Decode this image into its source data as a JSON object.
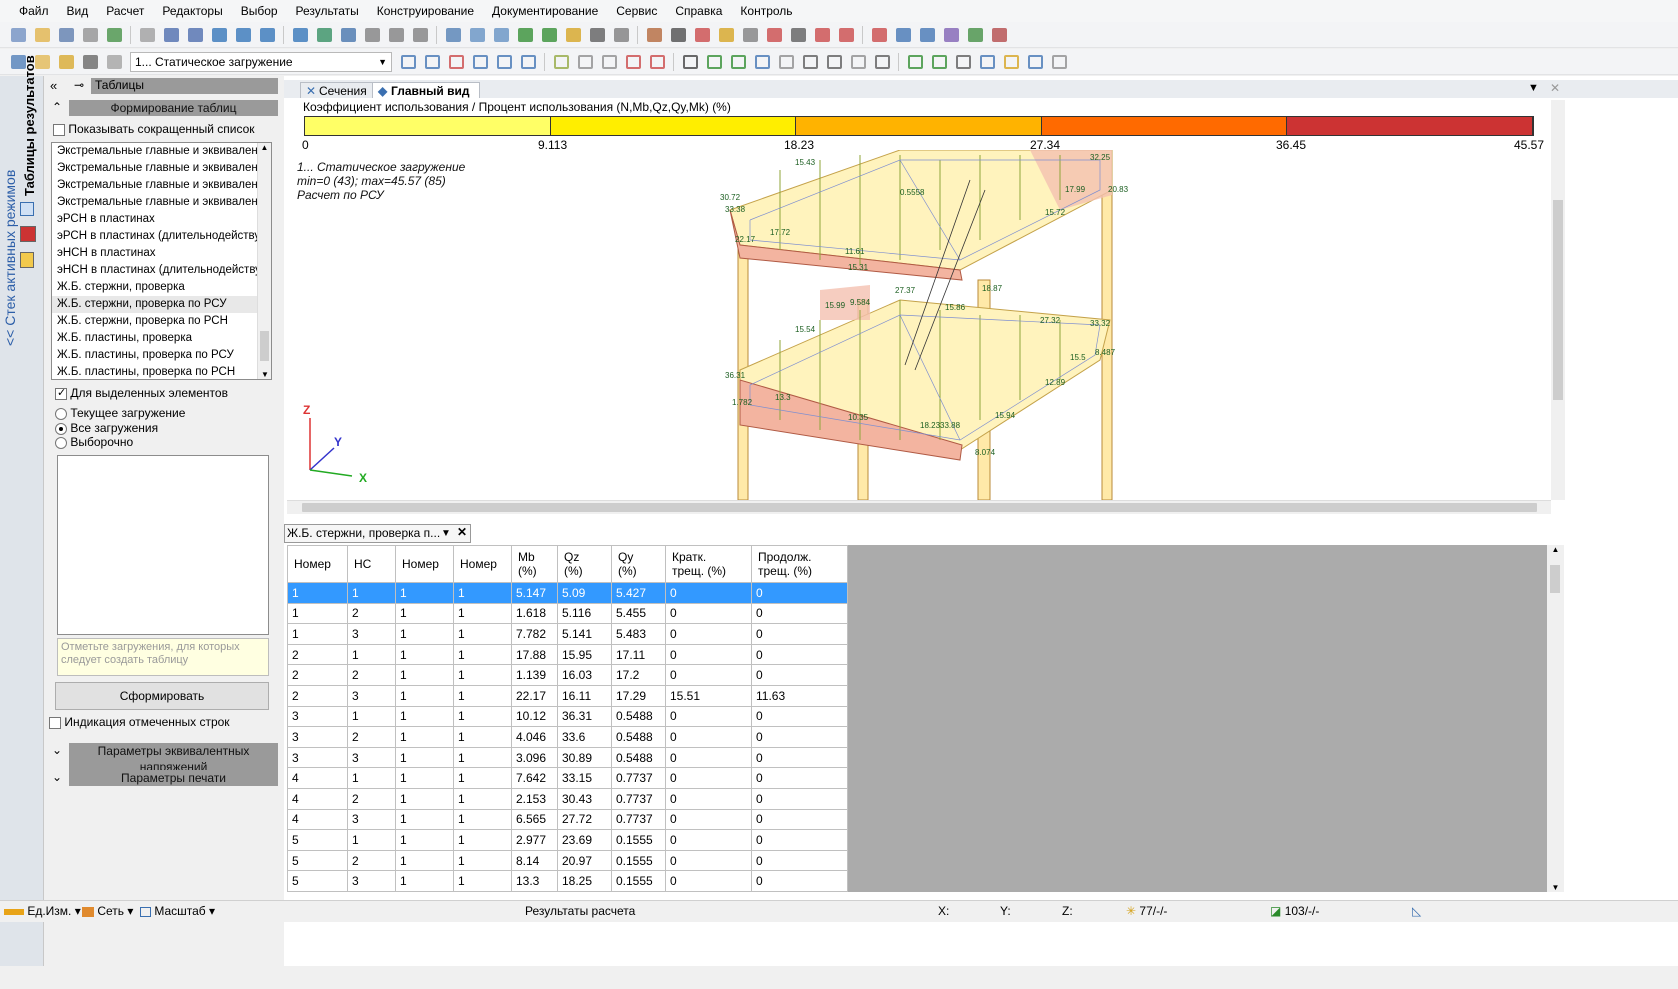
{
  "menu": [
    "Файл",
    "Вид",
    "Расчет",
    "Редакторы",
    "Выбор",
    "Результаты",
    "Конструирование",
    "Документирование",
    "Сервис",
    "Справка",
    "Контроль"
  ],
  "toolbar": {
    "load_case": "1... Статическое загружение"
  },
  "side_tab": {
    "stack_label": "<< Стек активных режимов",
    "results_tables_label": "Таблицы результатов"
  },
  "left_panel": {
    "header_title": "Таблицы",
    "section_forming": "Формирование таблиц",
    "show_short_list": "Показывать сокращенный список",
    "list_items": [
      "Экстремальные главные и эквивалент...",
      "Экстремальные главные и эквивалент...",
      "Экстремальные главные и эквивалент...",
      "Экстремальные главные и эквивалент...",
      "эРСН в пластинах",
      "эРСН в пластинах (длительнодействую...",
      "эНСН в пластинах",
      "эНСН в пластинах (длительнодействую...",
      "Ж.Б. стержни, проверка",
      "Ж.Б. стержни, проверка по РСУ",
      "Ж.Б. стержни, проверка по РСН",
      "Ж.Б. пластины, проверка",
      "Ж.Б. пластины, проверка по РСУ",
      "Ж.Б. пластины, проверка по РСН"
    ],
    "selected_item_index": 9,
    "for_selected": "Для выделенных элементов",
    "radio_current": "Текущее загружение",
    "radio_all": "Все загружения",
    "radio_selective": "Выборочно",
    "hint": "Отметьте загружения, для которых следует создать таблицу",
    "form_button": "Сформировать",
    "indicate_rows": "Индикация отмеченных строк",
    "section_equiv": "Параметры эквивалентных напряжений",
    "section_print": "Параметры печати"
  },
  "view_tabs": {
    "sections": "Сечения",
    "main": "Главный вид"
  },
  "scale": {
    "title": "Коэффициент использования / Процент использования (N,Mb,Qz,Qy,Mk) (%)",
    "ticks": [
      "0",
      "9.113",
      "18.23",
      "27.34",
      "36.45",
      "45.57"
    ],
    "colors": [
      "#ffff66",
      "#ffee00",
      "#ffb300",
      "#ff6a00",
      "#cc3333"
    ]
  },
  "view_info": {
    "line1": "1... Статическое загружение",
    "line2": "min=0 (43); max=45.57 (85)",
    "line3": "Расчет по РСУ"
  },
  "axes": {
    "z": "Z",
    "y": "Y",
    "x": "X"
  },
  "model_labels": [
    "15.43",
    "32.25",
    "20.83",
    "17.99",
    "15.72",
    "30.72",
    "33.38",
    "22.17",
    "17.72",
    "11.61",
    "15.31",
    "27.37",
    "18.87",
    "9.584",
    "15.99",
    "15.54",
    "33.32",
    "27.32",
    "15.5",
    "8.487",
    "36.31",
    "12.89",
    "13.3",
    "10.35",
    "18.23",
    "33.88",
    "8.074",
    "1.782",
    "0.5558",
    "15.94",
    "15.86"
  ],
  "grid_tab": "Ж.Б. стержни, проверка п...",
  "table": {
    "headers": [
      "Номер",
      "НС",
      "Номер",
      "Номер",
      "Mb\n(%)",
      "Qz\n(%)",
      "Qy\n(%)",
      "Кратк.\nтрещ. (%)",
      "Продолж.\nтрещ. (%)"
    ],
    "rows": [
      [
        "1",
        "1",
        "1",
        "1",
        "5.147",
        "5.09",
        "5.427",
        "0",
        "0"
      ],
      [
        "1",
        "2",
        "1",
        "1",
        "1.618",
        "5.116",
        "5.455",
        "0",
        "0"
      ],
      [
        "1",
        "3",
        "1",
        "1",
        "7.782",
        "5.141",
        "5.483",
        "0",
        "0"
      ],
      [
        "2",
        "1",
        "1",
        "1",
        "17.88",
        "15.95",
        "17.11",
        "0",
        "0"
      ],
      [
        "2",
        "2",
        "1",
        "1",
        "1.139",
        "16.03",
        "17.2",
        "0",
        "0"
      ],
      [
        "2",
        "3",
        "1",
        "1",
        "22.17",
        "16.11",
        "17.29",
        "15.51",
        "11.63"
      ],
      [
        "3",
        "1",
        "1",
        "1",
        "10.12",
        "36.31",
        "0.5488",
        "0",
        "0"
      ],
      [
        "3",
        "2",
        "1",
        "1",
        "4.046",
        "33.6",
        "0.5488",
        "0",
        "0"
      ],
      [
        "3",
        "3",
        "1",
        "1",
        "3.096",
        "30.89",
        "0.5488",
        "0",
        "0"
      ],
      [
        "4",
        "1",
        "1",
        "1",
        "7.642",
        "33.15",
        "0.7737",
        "0",
        "0"
      ],
      [
        "4",
        "2",
        "1",
        "1",
        "2.153",
        "30.43",
        "0.7737",
        "0",
        "0"
      ],
      [
        "4",
        "3",
        "1",
        "1",
        "6.565",
        "27.72",
        "0.7737",
        "0",
        "0"
      ],
      [
        "5",
        "1",
        "1",
        "1",
        "2.977",
        "23.69",
        "0.1555",
        "0",
        "0"
      ],
      [
        "5",
        "2",
        "1",
        "1",
        "8.14",
        "20.97",
        "0.1555",
        "0",
        "0"
      ],
      [
        "5",
        "3",
        "1",
        "1",
        "13.3",
        "18.25",
        "0.1555",
        "0",
        "0"
      ]
    ]
  },
  "status": {
    "units": "Ед.Изм.",
    "grid": "Сеть",
    "scale": "Масштаб",
    "center": "Результаты расчета",
    "x": "X:",
    "y": "Y:",
    "z": "Z:",
    "nodes": "77/-/-",
    "elements": "103/-/-"
  }
}
